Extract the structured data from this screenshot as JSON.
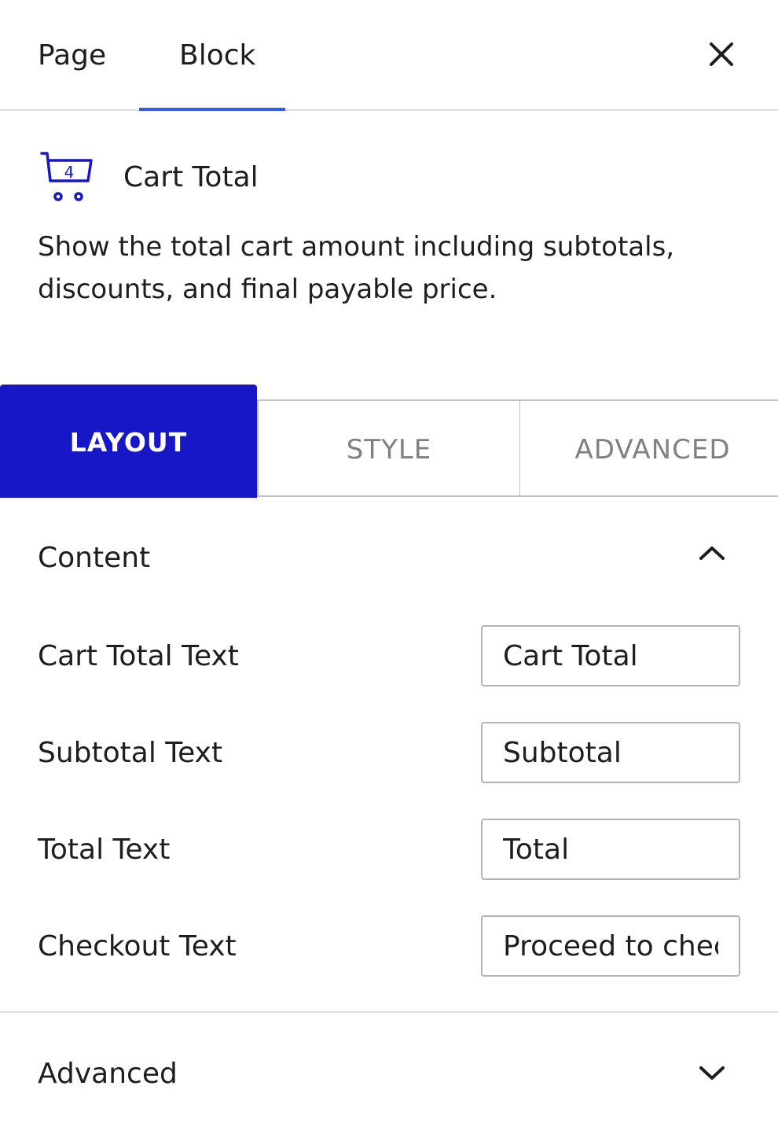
{
  "tabs": {
    "page": "Page",
    "block": "Block"
  },
  "block": {
    "title": "Cart Total",
    "icon_badge": "4",
    "description": "Show the total cart amount including subtotals, discounts, and final payable price."
  },
  "settings_tabs": {
    "layout": "LAYOUT",
    "style": "STYLE",
    "advanced": "ADVANCED"
  },
  "content_section": {
    "title": "Content",
    "fields": [
      {
        "label": "Cart Total Text",
        "value": "Cart Total"
      },
      {
        "label": "Subtotal Text",
        "value": "Subtotal"
      },
      {
        "label": "Total Text",
        "value": "Total"
      },
      {
        "label": "Checkout Text",
        "value": "Proceed to checkout"
      }
    ]
  },
  "advanced_section": {
    "title": "Advanced"
  },
  "colors": {
    "accent": "#1717c8",
    "tab_indicator": "#3858e9",
    "border": "#b4b4b4"
  }
}
